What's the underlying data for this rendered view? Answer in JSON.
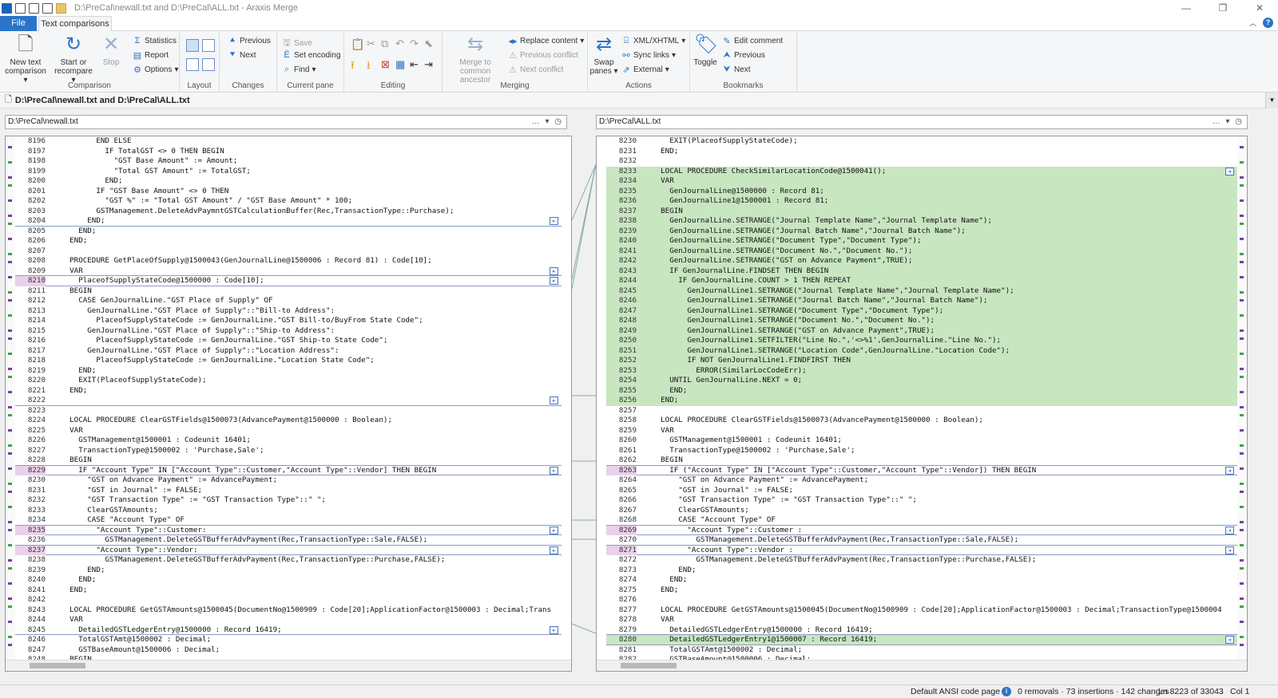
{
  "window": {
    "title": "D:\\PreCal\\newall.txt and D:\\PreCal\\ALL.txt - Araxis Merge"
  },
  "ribbon_tabs": {
    "file": "File",
    "active": "Text comparisons"
  },
  "ribbon": {
    "comparison": {
      "label": "Comparison",
      "new_text": "New text comparison",
      "start": "Start or recompare",
      "stop": "Stop",
      "statistics": "Statistics",
      "report": "Report",
      "options": "Options"
    },
    "layout": {
      "label": "Layout"
    },
    "changes": {
      "label": "Changes",
      "previous": "Previous",
      "next": "Next"
    },
    "current_pane": {
      "label": "Current pane",
      "save": "Save",
      "set_encoding": "Set encoding",
      "find": "Find"
    },
    "editing": {
      "label": "Editing"
    },
    "merging": {
      "label": "Merging",
      "merge_ancestor": "Merge to common ancestor",
      "replace_content": "Replace content",
      "previous_conflict": "Previous conflict",
      "next_conflict": "Next conflict"
    },
    "actions": {
      "label": "Actions",
      "swap_panes": "Swap panes",
      "xml": "XML/XHTML",
      "sync_links": "Sync links",
      "external": "External"
    },
    "bookmarks": {
      "label": "Bookmarks",
      "toggle": "Toggle",
      "edit_comment": "Edit comment",
      "previous": "Previous",
      "next": "Next"
    }
  },
  "docbar": {
    "title": "D:\\PreCal\\newall.txt and D:\\PreCal\\ALL.txt"
  },
  "left_pane": {
    "path": "D:\\PreCal\\newall.txt",
    "lines": [
      {
        "no": "8196",
        "text": "          END ELSE"
      },
      {
        "no": "8197",
        "text": "            IF TotalGST <> 0 THEN BEGIN"
      },
      {
        "no": "8198",
        "text": "              \"GST Base Amount\" := Amount;"
      },
      {
        "no": "8199",
        "text": "              \"Total GST Amount\" := TotalGST;"
      },
      {
        "no": "8200",
        "text": "            END;"
      },
      {
        "no": "8201",
        "text": "          IF \"GST Base Amount\" <> 0 THEN"
      },
      {
        "no": "8202",
        "text": "            \"GST %\" := \"Total GST Amount\" / \"GST Base Amount\" * 100;"
      },
      {
        "no": "8203",
        "text": "          GSTManagement.DeleteAdvPaymntGSTCalculationBuffer(Rec,TransactionType::Purchase);"
      },
      {
        "no": "8204",
        "text": "        END;"
      },
      {
        "no": "8205",
        "text": "      END;"
      },
      {
        "no": "8206",
        "text": "    END;"
      },
      {
        "no": "8207",
        "text": ""
      },
      {
        "no": "8208",
        "text": "    PROCEDURE GetPlaceOfSupply@1500043(GenJournalLine@1500006 : Record 81) : Code[10];"
      },
      {
        "no": "8209",
        "text": "    VAR"
      },
      {
        "no": "8210",
        "text": "      PlaceofSupplyStateCode@1500000 : Code[10];"
      },
      {
        "no": "8211",
        "text": "    BEGIN"
      },
      {
        "no": "8212",
        "text": "      CASE GenJournalLine.\"GST Place of Supply\" OF"
      },
      {
        "no": "8213",
        "text": "        GenJournalLine.\"GST Place of Supply\"::\"Bill-to Address\":"
      },
      {
        "no": "8214",
        "text": "          PlaceofSupplyStateCode := GenJournalLine.\"GST Bill-to/BuyFrom State Code\";"
      },
      {
        "no": "8215",
        "text": "        GenJournalLine.\"GST Place of Supply\"::\"Ship-to Address\":"
      },
      {
        "no": "8216",
        "text": "          PlaceofSupplyStateCode := GenJournalLine.\"GST Ship-to State Code\";"
      },
      {
        "no": "8217",
        "text": "        GenJournalLine.\"GST Place of Supply\"::\"Location Address\":"
      },
      {
        "no": "8218",
        "text": "          PlaceofSupplyStateCode := GenJournalLine.\"Location State Code\";"
      },
      {
        "no": "8219",
        "text": "      END;"
      },
      {
        "no": "8220",
        "text": "      EXIT(PlaceofSupplyStateCode);"
      },
      {
        "no": "8221",
        "text": "    END;"
      },
      {
        "no": "8222",
        "text": ""
      },
      {
        "no": "8223",
        "text": ""
      },
      {
        "no": "8224",
        "text": "    LOCAL PROCEDURE ClearGSTFields@1500073(AdvancePayment@1500000 : Boolean);"
      },
      {
        "no": "8225",
        "text": "    VAR"
      },
      {
        "no": "8226",
        "text": "      GSTManagement@1500001 : Codeunit 16401;"
      },
      {
        "no": "8227",
        "text": "      TransactionType@1500002 : 'Purchase,Sale';"
      },
      {
        "no": "8228",
        "text": "    BEGIN"
      },
      {
        "no": "8229",
        "text": "      IF \"Account Type\" IN [\"Account Type\"::Customer,\"Account Type\"::Vendor] THEN BEGIN"
      },
      {
        "no": "8230",
        "text": "        \"GST on Advance Payment\" := AdvancePayment;"
      },
      {
        "no": "8231",
        "text": "        \"GST in Journal\" := FALSE;"
      },
      {
        "no": "8232",
        "text": "        \"GST Transaction Type\" := \"GST Transaction Type\"::\" \";"
      },
      {
        "no": "8233",
        "text": "        ClearGSTAmounts;"
      },
      {
        "no": "8234",
        "text": "        CASE \"Account Type\" OF"
      },
      {
        "no": "8235",
        "text": "          \"Account Type\"::Customer:"
      },
      {
        "no": "8236",
        "text": "            GSTManagement.DeleteGSTBufferAdvPayment(Rec,TransactionType::Sale,FALSE);"
      },
      {
        "no": "8237",
        "text": "          \"Account Type\"::Vendor:"
      },
      {
        "no": "8238",
        "text": "            GSTManagement.DeleteGSTBufferAdvPayment(Rec,TransactionType::Purchase,FALSE);"
      },
      {
        "no": "8239",
        "text": "        END;"
      },
      {
        "no": "8240",
        "text": "      END;"
      },
      {
        "no": "8241",
        "text": "    END;"
      },
      {
        "no": "8242",
        "text": ""
      },
      {
        "no": "8243",
        "text": "    LOCAL PROCEDURE GetGSTAmounts@1500045(DocumentNo@1500909 : Code[20];ApplicationFactor@1500003 : Decimal;Trans"
      },
      {
        "no": "8244",
        "text": "    VAR"
      },
      {
        "no": "8245",
        "text": "      DetailedGSTLedgerEntry@1500000 : Record 16419;"
      },
      {
        "no": "8246",
        "text": "      TotalGSTAmt@1500002 : Decimal;"
      },
      {
        "no": "8247",
        "text": "      GSTBaseAmount@1500006 : Decimal;"
      },
      {
        "no": "8248",
        "text": "    BEGIN"
      },
      {
        "no": "8249",
        "text": "      DetailedGSTLedgerEntry.RESET;"
      }
    ]
  },
  "right_pane": {
    "path": "D:\\PreCal\\ALL.txt",
    "lines": [
      {
        "no": "8230",
        "text": "      EXIT(PlaceofSupplyStateCode);"
      },
      {
        "no": "8231",
        "text": "    END;"
      },
      {
        "no": "8232",
        "text": ""
      },
      {
        "no": "8233",
        "text": "    LOCAL PROCEDURE CheckSimilarLocationCode@1500041();"
      },
      {
        "no": "8234",
        "text": "    VAR"
      },
      {
        "no": "8235",
        "text": "      GenJournalLine@1500000 : Record 81;"
      },
      {
        "no": "8236",
        "text": "      GenJournalLine1@1500001 : Record 81;"
      },
      {
        "no": "8237",
        "text": "    BEGIN"
      },
      {
        "no": "8238",
        "text": "      GenJournalLine.SETRANGE(\"Journal Template Name\",\"Journal Template Name\");"
      },
      {
        "no": "8239",
        "text": "      GenJournalLine.SETRANGE(\"Journal Batch Name\",\"Journal Batch Name\");"
      },
      {
        "no": "8240",
        "text": "      GenJournalLine.SETRANGE(\"Document Type\",\"Document Type\");"
      },
      {
        "no": "8241",
        "text": "      GenJournalLine.SETRANGE(\"Document No.\",\"Document No.\");"
      },
      {
        "no": "8242",
        "text": "      GenJournalLine.SETRANGE(\"GST on Advance Payment\",TRUE);"
      },
      {
        "no": "8243",
        "text": "      IF GenJournalLine.FINDSET THEN BEGIN"
      },
      {
        "no": "8244",
        "text": "        IF GenJournalLine.COUNT > 1 THEN REPEAT"
      },
      {
        "no": "8245",
        "text": "          GenJournalLine1.SETRANGE(\"Journal Template Name\",\"Journal Template Name\");"
      },
      {
        "no": "8246",
        "text": "          GenJournalLine1.SETRANGE(\"Journal Batch Name\",\"Journal Batch Name\");"
      },
      {
        "no": "8247",
        "text": "          GenJournalLine1.SETRANGE(\"Document Type\",\"Document Type\");"
      },
      {
        "no": "8248",
        "text": "          GenJournalLine1.SETRANGE(\"Document No.\",\"Document No.\");"
      },
      {
        "no": "8249",
        "text": "          GenJournalLine1.SETRANGE(\"GST on Advance Payment\",TRUE);"
      },
      {
        "no": "8250",
        "text": "          GenJournalLine1.SETFILTER(\"Line No.\",'<>%1',GenJournalLine.\"Line No.\");"
      },
      {
        "no": "8251",
        "text": "          GenJournalLine1.SETRANGE(\"Location Code\",GenJournalLine.\"Location Code\");"
      },
      {
        "no": "8252",
        "text": "          IF NOT GenJournalLine1.FINDFIRST THEN"
      },
      {
        "no": "8253",
        "text": "            ERROR(SimilarLocCodeErr);"
      },
      {
        "no": "8254",
        "text": "      UNTIL GenJournalLine.NEXT = 0;"
      },
      {
        "no": "8255",
        "text": "      END;"
      },
      {
        "no": "8256",
        "text": "    END;"
      },
      {
        "no": "8257",
        "text": ""
      },
      {
        "no": "8258",
        "text": "    LOCAL PROCEDURE ClearGSTFields@1500073(AdvancePayment@1500000 : Boolean);"
      },
      {
        "no": "8259",
        "text": "    VAR"
      },
      {
        "no": "8260",
        "text": "      GSTManagement@1500001 : Codeunit 16401;"
      },
      {
        "no": "8261",
        "text": "      TransactionType@1500002 : 'Purchase,Sale';"
      },
      {
        "no": "8262",
        "text": "    BEGIN"
      },
      {
        "no": "8263",
        "text": "      IF (\"Account Type\" IN [\"Account Type\"::Customer,\"Account Type\"::Vendor]) THEN BEGIN"
      },
      {
        "no": "8264",
        "text": "        \"GST on Advance Payment\" := AdvancePayment;"
      },
      {
        "no": "8265",
        "text": "        \"GST in Journal\" := FALSE;"
      },
      {
        "no": "8266",
        "text": "        \"GST Transaction Type\" := \"GST Transaction Type\"::\" \";"
      },
      {
        "no": "8267",
        "text": "        ClearGSTAmounts;"
      },
      {
        "no": "8268",
        "text": "        CASE \"Account Type\" OF"
      },
      {
        "no": "8269",
        "text": "          \"Account Type\"::Customer :"
      },
      {
        "no": "8270",
        "text": "            GSTManagement.DeleteGSTBufferAdvPayment(Rec,TransactionType::Sale,FALSE);"
      },
      {
        "no": "8271",
        "text": "          \"Account Type\"::Vendor :"
      },
      {
        "no": "8272",
        "text": "            GSTManagement.DeleteGSTBufferAdvPayment(Rec,TransactionType::Purchase,FALSE);"
      },
      {
        "no": "8273",
        "text": "        END;"
      },
      {
        "no": "8274",
        "text": "      END;"
      },
      {
        "no": "8275",
        "text": "    END;"
      },
      {
        "no": "8276",
        "text": ""
      },
      {
        "no": "8277",
        "text": "    LOCAL PROCEDURE GetGSTAmounts@1500045(DocumentNo@1500909 : Code[20];ApplicationFactor@1500003 : Decimal;TransactionType@1500004"
      },
      {
        "no": "8278",
        "text": "    VAR"
      },
      {
        "no": "8279",
        "text": "      DetailedGSTLedgerEntry@1500000 : Record 16419;"
      },
      {
        "no": "8280",
        "text": "      DetailedGSTLedgerEntry1@1500007 : Record 16419;"
      },
      {
        "no": "8281",
        "text": "      TotalGSTAmt@1500002 : Decimal;"
      },
      {
        "no": "8282",
        "text": "      GSTBaseAmount@1500006 : Decimal;"
      },
      {
        "no": "8283",
        "text": "    BEGIN"
      }
    ]
  },
  "status": {
    "encoding": "Default ANSI code page",
    "summary": "0 removals · 73 insertions · 142 changes",
    "position": "Ln 8223 of 33043",
    "column": "Col 1"
  },
  "colors": {
    "accent": "#2b74c7",
    "insertion": "#c8e6c0",
    "change_marker": "#ead0ea"
  }
}
